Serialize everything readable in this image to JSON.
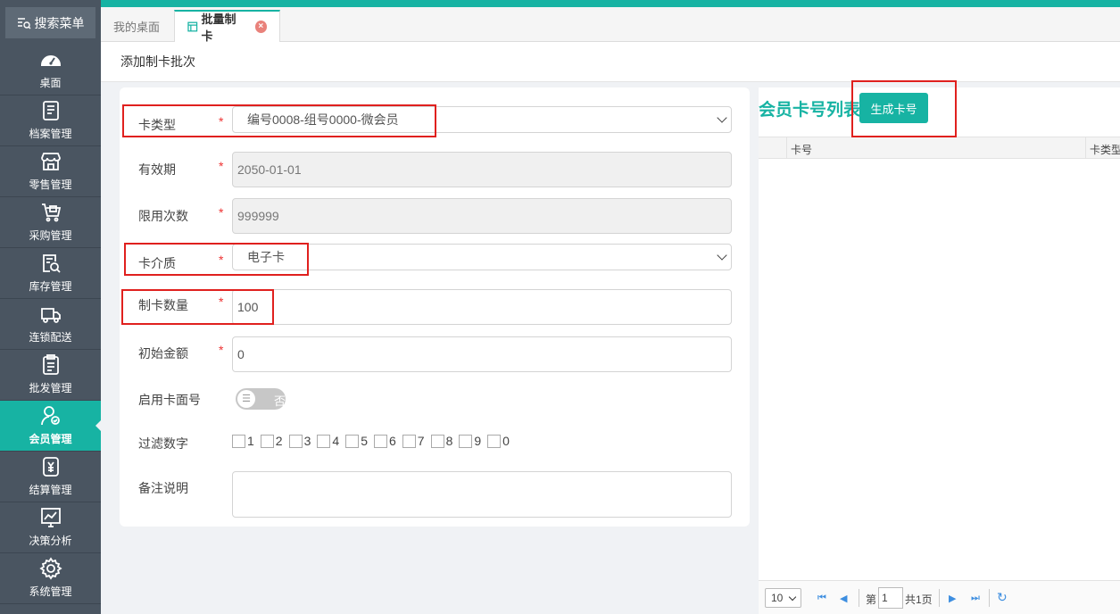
{
  "sidebar": {
    "search_label": "搜索菜单",
    "items": [
      {
        "label": "桌面",
        "icon": "dashboard-icon"
      },
      {
        "label": "档案管理",
        "icon": "archive-icon"
      },
      {
        "label": "零售管理",
        "icon": "store-icon"
      },
      {
        "label": "采购管理",
        "icon": "cart-icon"
      },
      {
        "label": "库存管理",
        "icon": "inventory-icon"
      },
      {
        "label": "连锁配送",
        "icon": "truck-icon"
      },
      {
        "label": "批发管理",
        "icon": "clipboard-icon"
      },
      {
        "label": "会员管理",
        "icon": "member-icon"
      },
      {
        "label": "结算管理",
        "icon": "settlement-icon"
      },
      {
        "label": "决策分析",
        "icon": "chart-icon"
      },
      {
        "label": "系统管理",
        "icon": "gear-icon"
      }
    ],
    "active_index": 7
  },
  "tabs": {
    "desk": "我的桌面",
    "active": "批量制卡",
    "close_symbol": "×"
  },
  "page": {
    "section_title": "添加制卡批次"
  },
  "form": {
    "card_type": {
      "label": "卡类型",
      "value": "编号0008-组号0000-微会员"
    },
    "validity": {
      "label": "有效期",
      "value": "2050-01-01"
    },
    "use_limit": {
      "label": "限用次数",
      "value": "999999"
    },
    "card_medium": {
      "label": "卡介质",
      "value": "电子卡"
    },
    "card_count": {
      "label": "制卡数量",
      "value": "100"
    },
    "initial_amount": {
      "label": "初始金额",
      "value": "0"
    },
    "enable_face_no": {
      "label": "启用卡面号",
      "state_label": "否",
      "knob_symbol": "☰"
    },
    "filter_digits": {
      "label": "过滤数字",
      "digits": [
        "1",
        "2",
        "3",
        "4",
        "5",
        "6",
        "7",
        "8",
        "9",
        "0"
      ]
    },
    "remarks": {
      "label": "备注说明",
      "value": ""
    },
    "required_mark": "*"
  },
  "card_list": {
    "title": "会员卡号列表",
    "generate_button": "生成卡号",
    "columns": [
      "卡号",
      "卡类型"
    ],
    "pager": {
      "page_size": "10",
      "page_prefix": "第",
      "current_page": "1",
      "total": "共1页"
    }
  },
  "colors": {
    "accent": "#17b3a3",
    "sidebar": "#4a5561",
    "highlight": "#e0201e"
  }
}
